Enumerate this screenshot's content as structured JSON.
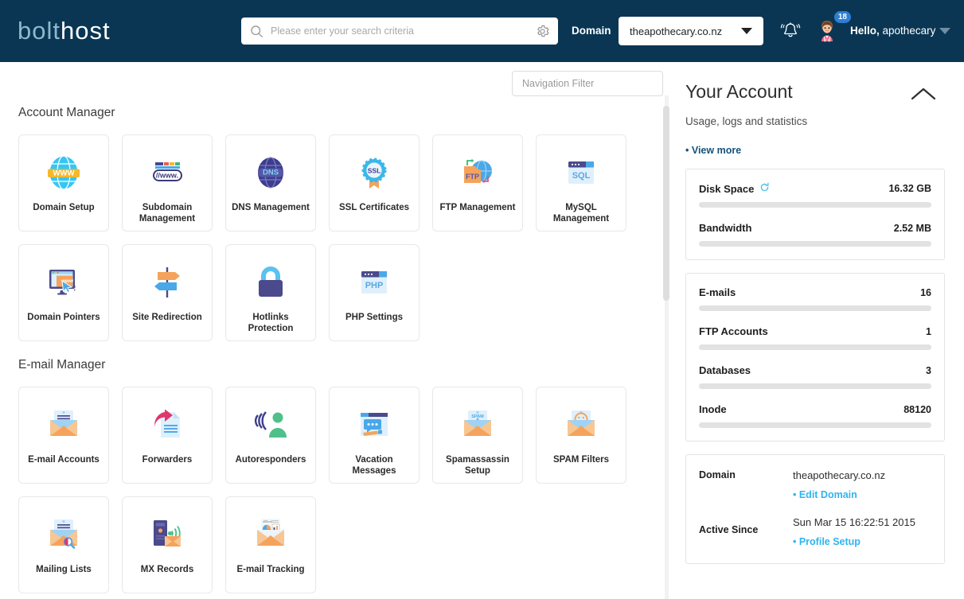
{
  "header": {
    "logo_bolt": "bolt",
    "logo_host": "host",
    "search_placeholder": "Please enter your search criteria",
    "search_value": "",
    "search_icon": "search-icon",
    "settings_icon": "gear-icon",
    "domain_label": "Domain",
    "domain_value": "theapothecary.co.nz",
    "notifications_icon": "bell-icon",
    "notification_count": "18",
    "greeting": "Hello,",
    "username": "apothecary"
  },
  "main": {
    "nav_filter_placeholder": "Navigation Filter",
    "nav_filter_value": "",
    "sections": [
      {
        "title": "Account Manager",
        "tiles": [
          {
            "label": "Domain Setup",
            "icon": "globe-www-icon"
          },
          {
            "label": "Subdomain Management",
            "icon": "browser-www-icon"
          },
          {
            "label": "DNS Management",
            "icon": "dns-globe-icon"
          },
          {
            "label": "SSL Certificates",
            "icon": "ssl-badge-icon"
          },
          {
            "label": "FTP Management",
            "icon": "ftp-folder-icon"
          },
          {
            "label": "MySQL Management",
            "icon": "sql-window-icon"
          },
          {
            "label": "Domain Pointers",
            "icon": "monitor-pointer-icon"
          },
          {
            "label": "Site Redirection",
            "icon": "signpost-icon"
          },
          {
            "label": "Hotlinks Protection",
            "icon": "padlock-icon"
          },
          {
            "label": "PHP Settings",
            "icon": "php-window-icon"
          }
        ]
      },
      {
        "title": "E-mail Manager",
        "tiles": [
          {
            "label": "E-mail Accounts",
            "icon": "envelope-password-icon"
          },
          {
            "label": "Forwarders",
            "icon": "forward-arrow-doc-icon"
          },
          {
            "label": "Autoresponders",
            "icon": "person-broadcast-icon"
          },
          {
            "label": "Vacation Messages",
            "icon": "chat-window-icon"
          },
          {
            "label": "Spamassassin Setup",
            "icon": "envelope-spam-alert-icon"
          },
          {
            "label": "SPAM Filters",
            "icon": "envelope-smiley-icon"
          },
          {
            "label": "Mailing Lists",
            "icon": "envelope-list-search-icon"
          },
          {
            "label": "MX Records",
            "icon": "server-envelope-icon"
          },
          {
            "label": "E-mail Tracking",
            "icon": "envelope-chart-icon"
          }
        ]
      }
    ]
  },
  "sidebar": {
    "title": "Your Account",
    "subtitle": "Usage, logs and statistics",
    "collapse_icon": "chevron-up-icon",
    "view_more": "• View more",
    "usage": [
      {
        "name": "Disk Space",
        "value": "16.32 GB",
        "refresh_icon": "refresh-icon",
        "percent": 0
      },
      {
        "name": "Bandwidth",
        "value": "2.52 MB",
        "percent": 0
      }
    ],
    "stats": [
      {
        "name": "E-mails",
        "value": "16",
        "percent": 0
      },
      {
        "name": "FTP Accounts",
        "value": "1",
        "percent": 0
      },
      {
        "name": "Databases",
        "value": "3",
        "percent": 0
      },
      {
        "name": "Inode",
        "value": "88120",
        "percent": 0
      }
    ],
    "info": {
      "domain_label": "Domain",
      "domain_value": "theapothecary.co.nz",
      "edit_domain_link": "• Edit Domain",
      "active_label": "Active Since",
      "active_value": "Sun Mar 15 16:22:51 2015",
      "profile_setup_link": "• Profile Setup"
    }
  },
  "colors": {
    "header_bg": "#0a3653",
    "accent_light_blue": "#2fb4f0",
    "link_dark_blue": "#16527c",
    "badge_blue": "#2d7fd3"
  }
}
